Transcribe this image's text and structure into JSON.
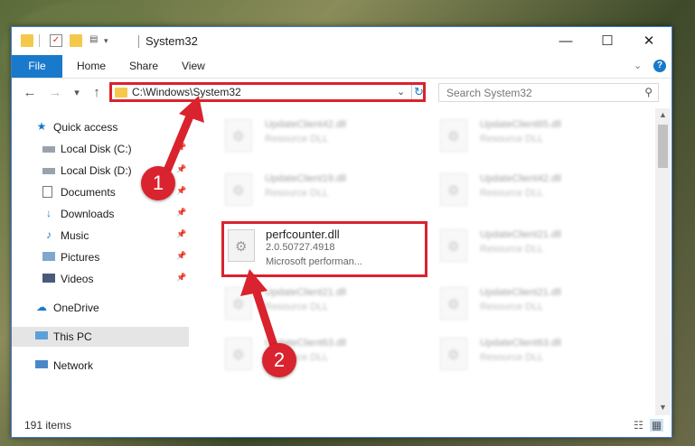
{
  "window": {
    "title": "System32",
    "minimize": "—",
    "maximize": "☐",
    "close": "✕"
  },
  "ribbon": {
    "tabs": [
      "File",
      "Home",
      "Share",
      "View"
    ],
    "help": "?"
  },
  "nav": {
    "back": "←",
    "forward": "→",
    "recent": "▾",
    "up": "↑",
    "address": "C:\\Windows\\System32",
    "search_placeholder": "Search System32"
  },
  "sidebar": {
    "items": [
      {
        "label": "Quick access",
        "icon": "star-icon"
      },
      {
        "label": "Local Disk (C:)",
        "icon": "drive-icon"
      },
      {
        "label": "Local Disk (D:)",
        "icon": "drive-icon"
      },
      {
        "label": "Documents",
        "icon": "documents-icon"
      },
      {
        "label": "Downloads",
        "icon": "download-arrow-icon"
      },
      {
        "label": "Music",
        "icon": "music-note-icon"
      },
      {
        "label": "Pictures",
        "icon": "pictures-icon"
      },
      {
        "label": "Videos",
        "icon": "film-icon"
      },
      {
        "label": "OneDrive",
        "icon": "cloud-icon"
      },
      {
        "label": "This PC",
        "icon": "monitor-icon"
      },
      {
        "label": "Network",
        "icon": "network-icon"
      }
    ]
  },
  "files": {
    "left": [
      {
        "name": "UpdateClient42.dll",
        "desc": "Resource DLL"
      },
      {
        "name": "UpdateClient19.dll",
        "desc": "Resource DLL"
      },
      {
        "name": "perfcounter.dll",
        "desc": "2.0.50727.4918",
        "desc2": "Microsoft performan..."
      },
      {
        "name": "UpdateClient21.dll",
        "desc": "Resource DLL"
      },
      {
        "name": "UpdateClient63.dll",
        "desc": "Resource DLL"
      }
    ],
    "right": [
      {
        "name": "UpdateClient65.dll",
        "desc": "Resource DLL"
      },
      {
        "name": "UpdateClient42.dll",
        "desc": "Resource DLL"
      },
      {
        "name": "UpdateClient21.dll",
        "desc": "Resource DLL"
      },
      {
        "name": "UpdateClient21.dll",
        "desc": "Resource DLL"
      },
      {
        "name": "UpdateClient63.dll",
        "desc": "Resource DLL"
      }
    ]
  },
  "status": {
    "count": "191 items"
  },
  "annotations": {
    "step1": "1",
    "step2": "2",
    "color": "#d9232e"
  }
}
